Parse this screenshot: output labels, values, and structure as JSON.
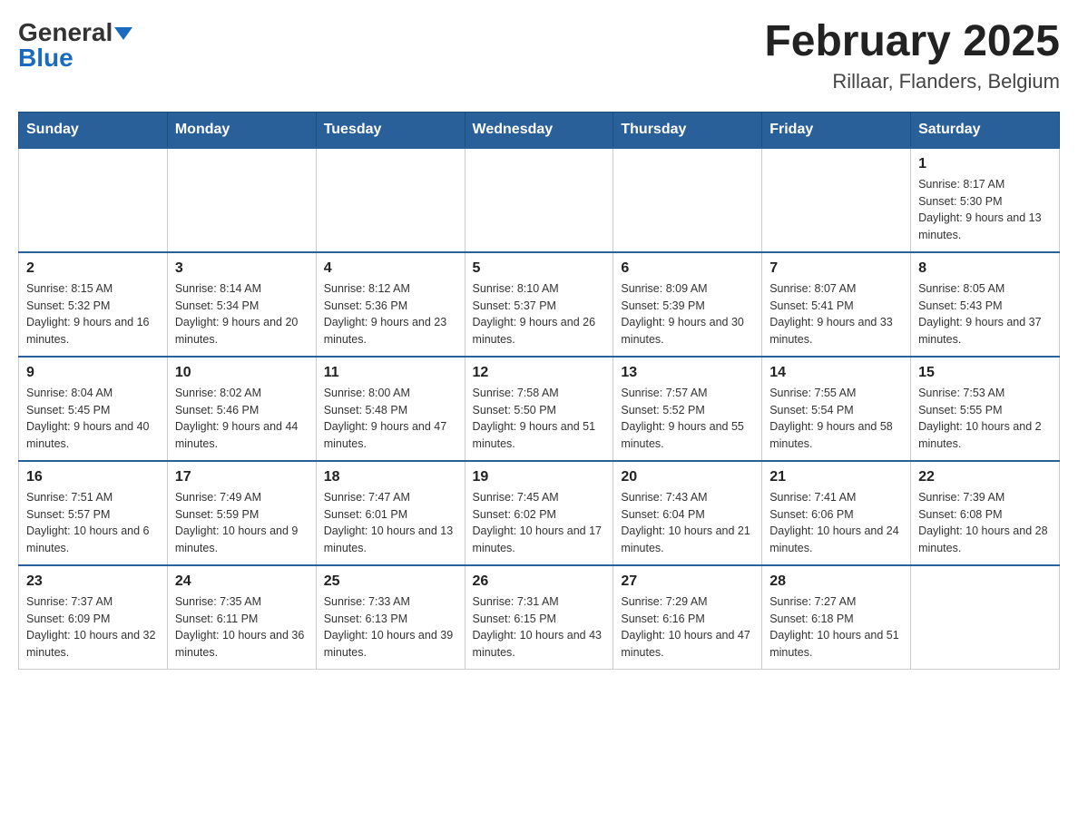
{
  "header": {
    "logo_general": "General",
    "logo_blue": "Blue",
    "title": "February 2025",
    "subtitle": "Rillaar, Flanders, Belgium"
  },
  "weekdays": [
    "Sunday",
    "Monday",
    "Tuesday",
    "Wednesday",
    "Thursday",
    "Friday",
    "Saturday"
  ],
  "weeks": [
    [
      {
        "day": "",
        "info": ""
      },
      {
        "day": "",
        "info": ""
      },
      {
        "day": "",
        "info": ""
      },
      {
        "day": "",
        "info": ""
      },
      {
        "day": "",
        "info": ""
      },
      {
        "day": "",
        "info": ""
      },
      {
        "day": "1",
        "info": "Sunrise: 8:17 AM\nSunset: 5:30 PM\nDaylight: 9 hours and 13 minutes."
      }
    ],
    [
      {
        "day": "2",
        "info": "Sunrise: 8:15 AM\nSunset: 5:32 PM\nDaylight: 9 hours and 16 minutes."
      },
      {
        "day": "3",
        "info": "Sunrise: 8:14 AM\nSunset: 5:34 PM\nDaylight: 9 hours and 20 minutes."
      },
      {
        "day": "4",
        "info": "Sunrise: 8:12 AM\nSunset: 5:36 PM\nDaylight: 9 hours and 23 minutes."
      },
      {
        "day": "5",
        "info": "Sunrise: 8:10 AM\nSunset: 5:37 PM\nDaylight: 9 hours and 26 minutes."
      },
      {
        "day": "6",
        "info": "Sunrise: 8:09 AM\nSunset: 5:39 PM\nDaylight: 9 hours and 30 minutes."
      },
      {
        "day": "7",
        "info": "Sunrise: 8:07 AM\nSunset: 5:41 PM\nDaylight: 9 hours and 33 minutes."
      },
      {
        "day": "8",
        "info": "Sunrise: 8:05 AM\nSunset: 5:43 PM\nDaylight: 9 hours and 37 minutes."
      }
    ],
    [
      {
        "day": "9",
        "info": "Sunrise: 8:04 AM\nSunset: 5:45 PM\nDaylight: 9 hours and 40 minutes."
      },
      {
        "day": "10",
        "info": "Sunrise: 8:02 AM\nSunset: 5:46 PM\nDaylight: 9 hours and 44 minutes."
      },
      {
        "day": "11",
        "info": "Sunrise: 8:00 AM\nSunset: 5:48 PM\nDaylight: 9 hours and 47 minutes."
      },
      {
        "day": "12",
        "info": "Sunrise: 7:58 AM\nSunset: 5:50 PM\nDaylight: 9 hours and 51 minutes."
      },
      {
        "day": "13",
        "info": "Sunrise: 7:57 AM\nSunset: 5:52 PM\nDaylight: 9 hours and 55 minutes."
      },
      {
        "day": "14",
        "info": "Sunrise: 7:55 AM\nSunset: 5:54 PM\nDaylight: 9 hours and 58 minutes."
      },
      {
        "day": "15",
        "info": "Sunrise: 7:53 AM\nSunset: 5:55 PM\nDaylight: 10 hours and 2 minutes."
      }
    ],
    [
      {
        "day": "16",
        "info": "Sunrise: 7:51 AM\nSunset: 5:57 PM\nDaylight: 10 hours and 6 minutes."
      },
      {
        "day": "17",
        "info": "Sunrise: 7:49 AM\nSunset: 5:59 PM\nDaylight: 10 hours and 9 minutes."
      },
      {
        "day": "18",
        "info": "Sunrise: 7:47 AM\nSunset: 6:01 PM\nDaylight: 10 hours and 13 minutes."
      },
      {
        "day": "19",
        "info": "Sunrise: 7:45 AM\nSunset: 6:02 PM\nDaylight: 10 hours and 17 minutes."
      },
      {
        "day": "20",
        "info": "Sunrise: 7:43 AM\nSunset: 6:04 PM\nDaylight: 10 hours and 21 minutes."
      },
      {
        "day": "21",
        "info": "Sunrise: 7:41 AM\nSunset: 6:06 PM\nDaylight: 10 hours and 24 minutes."
      },
      {
        "day": "22",
        "info": "Sunrise: 7:39 AM\nSunset: 6:08 PM\nDaylight: 10 hours and 28 minutes."
      }
    ],
    [
      {
        "day": "23",
        "info": "Sunrise: 7:37 AM\nSunset: 6:09 PM\nDaylight: 10 hours and 32 minutes."
      },
      {
        "day": "24",
        "info": "Sunrise: 7:35 AM\nSunset: 6:11 PM\nDaylight: 10 hours and 36 minutes."
      },
      {
        "day": "25",
        "info": "Sunrise: 7:33 AM\nSunset: 6:13 PM\nDaylight: 10 hours and 39 minutes."
      },
      {
        "day": "26",
        "info": "Sunrise: 7:31 AM\nSunset: 6:15 PM\nDaylight: 10 hours and 43 minutes."
      },
      {
        "day": "27",
        "info": "Sunrise: 7:29 AM\nSunset: 6:16 PM\nDaylight: 10 hours and 47 minutes."
      },
      {
        "day": "28",
        "info": "Sunrise: 7:27 AM\nSunset: 6:18 PM\nDaylight: 10 hours and 51 minutes."
      },
      {
        "day": "",
        "info": ""
      }
    ]
  ]
}
